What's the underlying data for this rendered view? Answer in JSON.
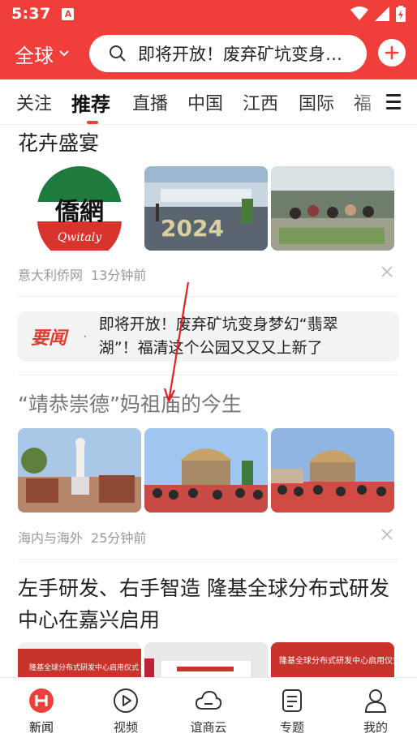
{
  "status_bar": {
    "time": "5:37",
    "notification_badge": "A"
  },
  "header": {
    "region": "全球",
    "search_text": "即将开放！废弃矿坑变身梦幻“翡翠湖”！",
    "accent_color": "#f03f3a"
  },
  "tabs": [
    {
      "label": "关注"
    },
    {
      "label": "推荐"
    },
    {
      "label": "直播"
    },
    {
      "label": "中国"
    },
    {
      "label": "江西"
    },
    {
      "label": "国际"
    },
    {
      "label": "福"
    }
  ],
  "feed": {
    "item1": {
      "title": "花卉盛宴",
      "logo_text": "僑網",
      "logo_sub": "Qwitaly",
      "poster_text": "2024",
      "source": "意大利侨网",
      "time": "13分钟前"
    },
    "flash": {
      "label": "要闻",
      "separator": "·",
      "text": "即将开放！废弃矿坑变身梦幻“翡翠湖”！福清这个公园又又又上新了"
    },
    "item2": {
      "title": "“靖恭崇德”妈祖庙的今生",
      "source": "海内与海外",
      "time": "25分钟前"
    },
    "item3": {
      "title": "左手研发、右手智造  隆基全球分布式研发中心在嘉兴启用",
      "banner_text": "隆基全球分布式研发中心启用仪式"
    }
  },
  "bottom_nav": [
    {
      "label": "新闻",
      "icon": "news-icon",
      "active": true
    },
    {
      "label": "视频",
      "icon": "video-play-icon",
      "active": false
    },
    {
      "label": "谊商云",
      "icon": "cloud-icon",
      "active": false
    },
    {
      "label": "专题",
      "icon": "topic-icon",
      "active": false
    },
    {
      "label": "我的",
      "icon": "user-icon",
      "active": false
    }
  ]
}
